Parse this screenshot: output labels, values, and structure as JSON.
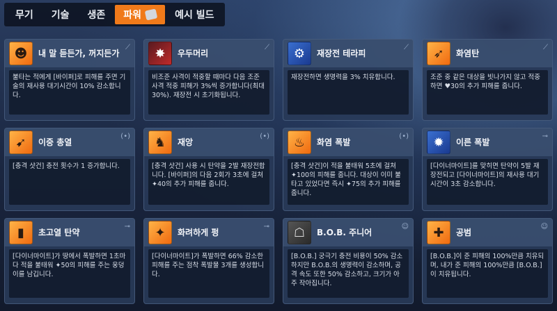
{
  "tabs": [
    {
      "label": "무기"
    },
    {
      "label": "기술"
    },
    {
      "label": "생존"
    },
    {
      "label": "파워"
    },
    {
      "label": "예시 빌드"
    }
  ],
  "active_tab": "파워",
  "cards": [
    {
      "title": "내 말 듣든가, 꺼지든가",
      "desc": "불타는 적에게 [바이퍼]로 피해를 주면 기술의 재사용 대기시간이 10% 감소합니다.",
      "icon": "person-icon",
      "badge": "⟋",
      "color": "orange"
    },
    {
      "title": "우두머리",
      "desc": "비조준 사격이 적중할 때마다 다음 조준 사격 적중 피해가 3%씩 증가합니다(최대 30%). 재장전 시 초기화됩니다.",
      "icon": "burst-icon",
      "badge": "⟋",
      "color": "red"
    },
    {
      "title": "재장전 테라피",
      "desc": "재장전하면 생명력을 3% 치유합니다.",
      "icon": "gun-icon",
      "badge": "⟋",
      "color": "blue"
    },
    {
      "title": "화염탄",
      "desc": "조준 중 같은 대상을 빗나가지 않고 적중하면 ♥30의 추가 피해를 줍니다.",
      "icon": "fire-bullet-icon",
      "badge": "⟋",
      "color": "orange"
    },
    {
      "title": "이중 총열",
      "desc": "[충격 샷건] 충전 횟수가 1 증가합니다.",
      "icon": "shotgun-icon",
      "badge": "(•)",
      "color": "orange"
    },
    {
      "title": "재앙",
      "desc": "[충격 샷건] 사용 시 탄약을 2발 재장전합니다. [바이퍼]의 다음 2회가 3초에 걸쳐 ✦40의 추가 피해를 줍니다.",
      "icon": "hat-icon",
      "badge": "(•)",
      "color": "orange"
    },
    {
      "title": "화염 폭발",
      "desc": "[충격 샷건]이 적을 불태워 5초에 걸쳐 ✦100의 피해를 줍니다. 대상이 이미 불타고 있었다면 즉시 ✦75의 추가 피해를 줍니다.",
      "icon": "flame-icon",
      "badge": "(•)",
      "color": "orange"
    },
    {
      "title": "이른 폭발",
      "desc": "[다이너마이트]를 맞히면 탄약이 5발 재장전되고 [다이너마이트]의 재사용 대기시간이 3초 감소합니다.",
      "icon": "dynamite-icon",
      "badge": "⊸",
      "color": "blue"
    },
    {
      "title": "초고열 탄약",
      "desc": "[다이너마이트]가 땅에서 폭발하면 1초마다 적을 불태워 ✦50의 피해를 주는 웅덩이를 남깁니다.",
      "icon": "ammo-icon",
      "badge": "⊸",
      "color": "orange"
    },
    {
      "title": "화려하게 펑",
      "desc": "[다이너마이트]가 폭발하면 66% 감소한 피해를 주는 점착 폭발물 3개를 생성합니다.",
      "icon": "bomb-icon",
      "badge": "⊸",
      "color": "orange"
    },
    {
      "title": "B.O.B. 주니어",
      "desc": "[B.O.B.] 궁극기 충전 비용이 50% 감소하지만 B.O.B.의 생명력이 감소하며, 공격 속도 또한 50% 감소하고, 크기가 아주 작아집니다.",
      "icon": "robot-icon",
      "badge": "☺",
      "color": "dark"
    },
    {
      "title": "공범",
      "desc": "[B.O.B.]이 준 피해의 100%만큼 치유되며, 내가 준 피해의 100%만큼 [B.O.B.]이 치유됩니다.",
      "icon": "cross-icon",
      "badge": "☺",
      "color": "orange"
    }
  ]
}
